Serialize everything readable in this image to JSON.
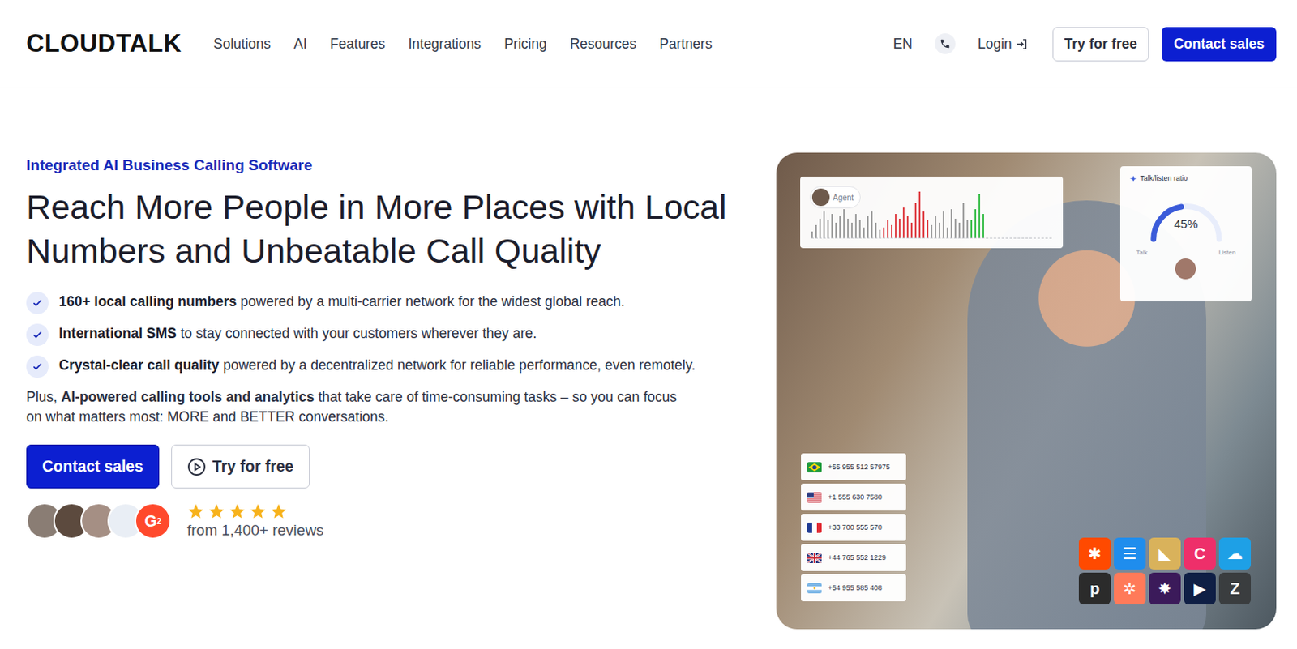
{
  "logo": "CLOUDTALK",
  "nav": {
    "items": [
      "Solutions",
      "AI",
      "Features",
      "Integrations",
      "Pricing",
      "Resources",
      "Partners"
    ],
    "language": "EN",
    "login": "Login",
    "try_button": "Try for free",
    "contact_button": "Contact sales"
  },
  "hero": {
    "eyebrow": "Integrated AI Business Calling Software",
    "title": "Reach More People in More Places with Local Numbers and Unbeatable Call Quality",
    "bullets": [
      {
        "bold": "160+ local calling numbers",
        "rest": " powered by a multi-carrier network for the widest global reach."
      },
      {
        "bold": "International SMS",
        "rest": " to stay connected with your customers wherever they are."
      },
      {
        "bold": "Crystal-clear call quality",
        "rest": " powered by a decentralized network for reliable performance, even remotely."
      }
    ],
    "plus": {
      "prefix": "Plus, ",
      "bold": "AI-powered calling tools and analytics",
      "rest": " that take care of time-consuming tasks – so you can focus on what matters most: MORE and BETTER conversations."
    },
    "contact_button": "Contact sales",
    "try_button": "Try for free",
    "reviews": {
      "stars": 5,
      "text": "from 1,400+ reviews",
      "avatars": [
        {
          "color": "#8a7d74"
        },
        {
          "color": "#5c4a3e"
        },
        {
          "color": "#a58f84"
        },
        {
          "color": "#e9eef5"
        }
      ],
      "badge": {
        "letter": "G",
        "sup": "2"
      }
    }
  },
  "visual": {
    "agent_card": {
      "label": "Agent",
      "segments": [
        {
          "color": "#a3a3a3",
          "values": [
            0.1,
            0.25,
            0.4,
            0.55,
            0.35,
            0.5,
            0.3,
            0.45,
            0.6,
            0.4,
            0.3,
            0.5,
            0.35,
            0.2,
            0.45,
            0.55,
            0.3,
            0.15
          ]
        },
        {
          "color": "#e0474c",
          "values": [
            0.2,
            0.35,
            0.25,
            0.5,
            0.4,
            0.65,
            0.45,
            0.3,
            0.75,
            1.0,
            0.55,
            0.35
          ]
        },
        {
          "color": "#a3a3a3",
          "values": [
            0.25,
            0.45,
            0.3,
            0.55,
            0.2,
            0.6,
            0.4,
            0.3,
            0.75,
            0.35
          ]
        },
        {
          "color": "#3fbf4f",
          "values": [
            0.35,
            0.6,
            0.95,
            0.5
          ]
        }
      ]
    },
    "ratio_card": {
      "title": "Talk/listen ratio",
      "value": "45%",
      "level": 0.45,
      "left": "Talk",
      "right": "Listen"
    },
    "numbers": [
      {
        "flag": "br",
        "number": "+55 955 512 57975"
      },
      {
        "flag": "us",
        "number": "+1 555 630 7580"
      },
      {
        "flag": "fr",
        "number": "+33 700 555 570"
      },
      {
        "flag": "gb",
        "number": "+44 765 552 1229"
      },
      {
        "flag": "ar",
        "number": "+54 955 585 408"
      }
    ],
    "integrations": [
      {
        "glyph": "✱",
        "color": "#ff4a00"
      },
      {
        "glyph": "☰",
        "color": "#1f8ded"
      },
      {
        "glyph": "◣",
        "color": "#d9b25b"
      },
      {
        "glyph": "C",
        "color": "#ee2f6a"
      },
      {
        "glyph": "☁",
        "color": "#1ea0e6"
      },
      {
        "glyph": "p",
        "color": "#2b2b2b"
      },
      {
        "glyph": "✲",
        "color": "#ff7a59"
      },
      {
        "glyph": "✸",
        "color": "#3b1a5a"
      },
      {
        "glyph": "▶",
        "color": "#0f1f45"
      },
      {
        "glyph": "Z",
        "color": "#3a3d3f"
      }
    ]
  }
}
